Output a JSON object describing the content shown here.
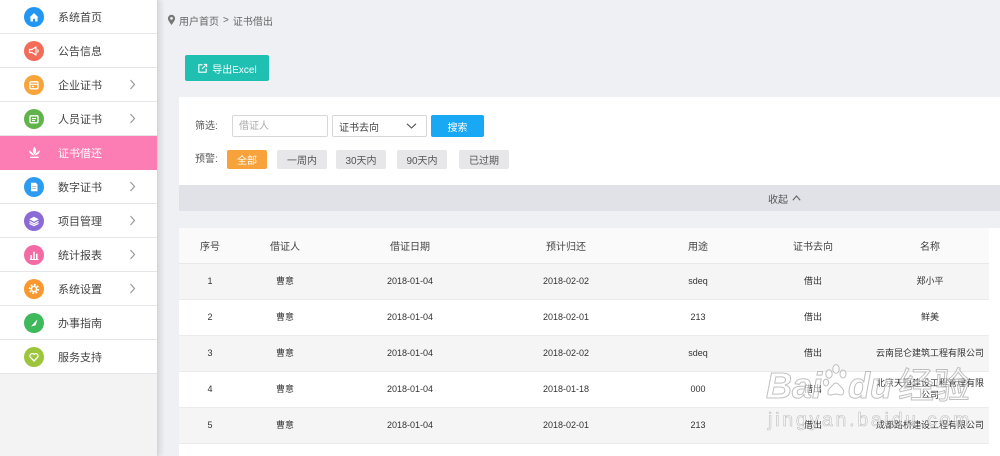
{
  "sidebar": {
    "active_color": "#fc7db3",
    "items": [
      {
        "label": "系统首页",
        "icon": "home-icon",
        "color": "#2196f3",
        "has_children": false,
        "active": false
      },
      {
        "label": "公告信息",
        "icon": "megaphone-icon",
        "color": "#f26c5a",
        "has_children": false,
        "active": false
      },
      {
        "label": "企业证书",
        "icon": "certificate-icon",
        "color": "#f7a43b",
        "has_children": true,
        "active": false
      },
      {
        "label": "人员证书",
        "icon": "id-card-icon",
        "color": "#62b34c",
        "has_children": true,
        "active": false
      },
      {
        "label": "证书借还",
        "icon": "lotus-icon",
        "has_children": false,
        "active": true
      },
      {
        "label": "数字证书",
        "icon": "document-icon",
        "color": "#2d9cf0",
        "has_children": true,
        "active": false
      },
      {
        "label": "项目管理",
        "icon": "layers-icon",
        "color": "#8b6ad6",
        "has_children": true,
        "active": false
      },
      {
        "label": "统计报表",
        "icon": "bar-chart-icon",
        "color": "#f36aa4",
        "has_children": true,
        "active": false
      },
      {
        "label": "系统设置",
        "icon": "gear-icon",
        "color": "#f8982e",
        "has_children": true,
        "active": false
      },
      {
        "label": "办事指南",
        "icon": "compass-icon",
        "color": "#3eb95c",
        "has_children": false,
        "active": false
      },
      {
        "label": "服务支持",
        "icon": "heart-icon",
        "color": "#9dc53b",
        "has_children": false,
        "active": false
      }
    ]
  },
  "breadcrumb": {
    "icon": "location-pin-icon",
    "home": "用户首页",
    "separator": ">",
    "current": "证书借出"
  },
  "toolbar": {
    "export_label": "导出Excel",
    "export_icon": "export-icon",
    "export_color": "#1fbfb2"
  },
  "filter": {
    "label": "筛选:",
    "borrower_placeholder": "借证人",
    "destination_select": {
      "selected": "证书去向"
    },
    "search_label": "搜索",
    "search_color": "#19a8f3",
    "warning_label": "预警:",
    "warning_active_color": "#f8a23c",
    "warning_options": [
      {
        "label": "全部",
        "active": true
      },
      {
        "label": "一周内",
        "active": false
      },
      {
        "label": "30天内",
        "active": false
      },
      {
        "label": "90天内",
        "active": false
      },
      {
        "label": "已过期",
        "active": false
      }
    ],
    "collapse_label": "收起"
  },
  "table": {
    "columns": [
      "序号",
      "借证人",
      "借证日期",
      "预计归还",
      "用途",
      "证书去向",
      "名称"
    ],
    "rows": [
      [
        "1",
        "曹意",
        "2018-01-04",
        "2018-02-02",
        "sdeq",
        "借出",
        "郑小平"
      ],
      [
        "2",
        "曹意",
        "2018-01-04",
        "2018-02-01",
        "213",
        "借出",
        "鲜美"
      ],
      [
        "3",
        "曹意",
        "2018-01-04",
        "2018-02-02",
        "sdeq",
        "借出",
        "云南昆仑建筑工程有限公司"
      ],
      [
        "4",
        "曹意",
        "2018-01-04",
        "2018-01-18",
        "000",
        "借出",
        "北京天恒建设工程管理有限公司"
      ],
      [
        "5",
        "曹意",
        "2018-01-04",
        "2018-02-01",
        "213",
        "借出",
        "成都路桥建设工程有限公司"
      ]
    ]
  },
  "watermark": {
    "bai": "Bai",
    "du": "du",
    "jingyan": "经验",
    "url": "jingyan.baidu.com"
  }
}
